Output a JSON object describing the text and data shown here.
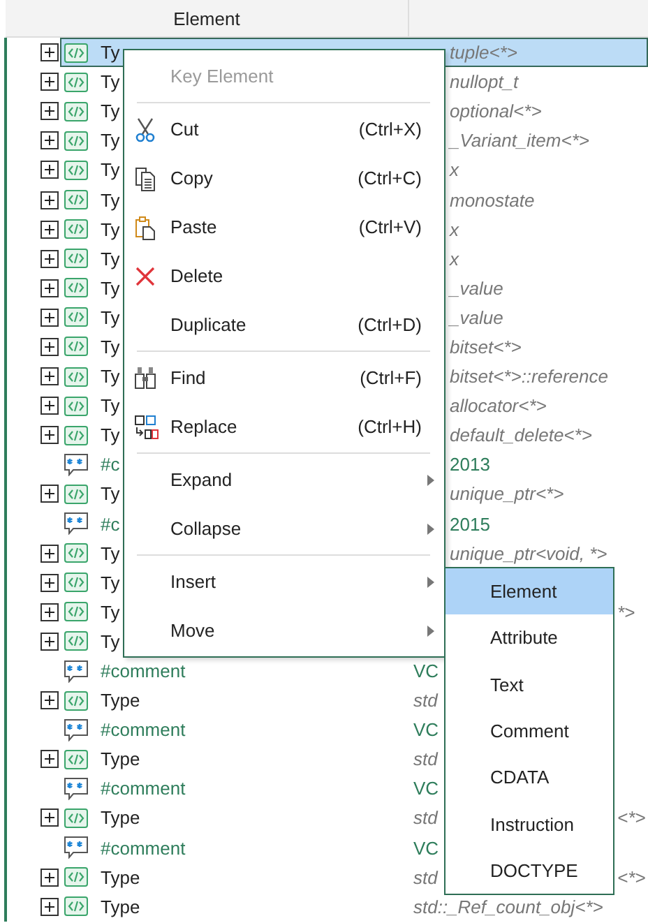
{
  "columns": [
    {
      "label": "Element"
    }
  ],
  "rows": [
    {
      "kind": "element",
      "name": "Ty",
      "value": "tuple<*>",
      "selected": true,
      "expanded": false
    },
    {
      "kind": "element",
      "name": "Ty",
      "value": "nullopt_t",
      "selected": false,
      "expanded": false
    },
    {
      "kind": "element",
      "name": "Ty",
      "value": "optional<*>",
      "selected": false,
      "expanded": false
    },
    {
      "kind": "element",
      "name": "Ty",
      "value": "_Variant_item<*>",
      "selected": false,
      "expanded": false
    },
    {
      "kind": "element",
      "name": "Ty",
      "value": "x",
      "selected": false,
      "expanded": false
    },
    {
      "kind": "element",
      "name": "Ty",
      "value": "monostate",
      "selected": false,
      "expanded": false
    },
    {
      "kind": "element",
      "name": "Ty",
      "value": "x",
      "selected": false,
      "expanded": false
    },
    {
      "kind": "element",
      "name": "Ty",
      "value": "x",
      "selected": false,
      "expanded": false
    },
    {
      "kind": "element",
      "name": "Ty",
      "value": "_value",
      "selected": false,
      "expanded": false
    },
    {
      "kind": "element",
      "name": "Ty",
      "value": "_value",
      "selected": false,
      "expanded": false
    },
    {
      "kind": "element",
      "name": "Ty",
      "value": "bitset<*>",
      "selected": false,
      "expanded": false
    },
    {
      "kind": "element",
      "name": "Ty",
      "value": "bitset<*>::reference",
      "selected": false,
      "expanded": false
    },
    {
      "kind": "element",
      "name": "Ty",
      "value": "allocator<*>",
      "selected": false,
      "expanded": false
    },
    {
      "kind": "element",
      "name": "Ty",
      "value": "default_delete<*>",
      "selected": false,
      "expanded": false
    },
    {
      "kind": "comment",
      "name": "#c",
      "value": "2013",
      "selected": false
    },
    {
      "kind": "element",
      "name": "Ty",
      "value": "unique_ptr<*>",
      "selected": false,
      "expanded": false
    },
    {
      "kind": "comment",
      "name": "#c",
      "value": "2015",
      "selected": false
    },
    {
      "kind": "element",
      "name": "Ty",
      "value": "unique_ptr<void, *>",
      "selected": false,
      "expanded": false
    },
    {
      "kind": "element",
      "name": "Ty",
      "selected": false,
      "expanded": false
    },
    {
      "kind": "element",
      "name": "Ty",
      "value_end": "*>",
      "selected": false,
      "expanded": false
    },
    {
      "kind": "element",
      "name": "Ty",
      "selected": false,
      "expanded": false
    },
    {
      "kind": "comment",
      "name": "#comment",
      "value": "VC",
      "selected": false
    },
    {
      "kind": "element",
      "name": "Type",
      "value": "std",
      "selected": false,
      "expanded": false
    },
    {
      "kind": "comment",
      "name": "#comment",
      "value": "VC",
      "selected": false
    },
    {
      "kind": "element",
      "name": "Type",
      "value": "std",
      "selected": false,
      "expanded": false
    },
    {
      "kind": "comment",
      "name": "#comment",
      "value": "VC",
      "selected": false
    },
    {
      "kind": "element",
      "name": "Type",
      "value": "std",
      "value_end": "<*>",
      "selected": false,
      "expanded": false
    },
    {
      "kind": "comment",
      "name": "#comment",
      "value": "VC",
      "selected": false
    },
    {
      "kind": "element",
      "name": "Type",
      "value": "std",
      "value_end": "<*>",
      "selected": false,
      "expanded": false
    },
    {
      "kind": "element",
      "name": "Type",
      "value": "std::_Ref_count_obj<*>",
      "selected": false,
      "expanded": false
    }
  ],
  "context_menu": {
    "items": [
      {
        "kind": "label",
        "label": "Key Element"
      },
      {
        "kind": "separator"
      },
      {
        "kind": "command",
        "label": "Cut",
        "shortcut": "(Ctrl+X)"
      },
      {
        "kind": "command",
        "label": "Copy",
        "shortcut": "(Ctrl+C)"
      },
      {
        "kind": "command",
        "label": "Paste",
        "shortcut": "(Ctrl+V)"
      },
      {
        "kind": "command",
        "label": "Delete"
      },
      {
        "kind": "command",
        "label": "Duplicate",
        "shortcut": "(Ctrl+D)"
      },
      {
        "kind": "separator"
      },
      {
        "kind": "command",
        "label": "Find",
        "shortcut": "(Ctrl+F)"
      },
      {
        "kind": "command",
        "label": "Replace",
        "shortcut": "(Ctrl+H)"
      },
      {
        "kind": "separator"
      },
      {
        "kind": "submenu",
        "label": "Expand"
      },
      {
        "kind": "submenu",
        "label": "Collapse"
      },
      {
        "kind": "separator"
      },
      {
        "kind": "submenu",
        "label": "Insert"
      },
      {
        "kind": "submenu",
        "label": "Move"
      }
    ]
  },
  "submenu": {
    "items": [
      {
        "label": "Element",
        "selected": true
      },
      {
        "label": "Attribute",
        "selected": false
      },
      {
        "label": "Text",
        "selected": false
      },
      {
        "label": "Comment",
        "selected": false
      },
      {
        "label": "CDATA",
        "selected": false
      },
      {
        "label": "Instruction",
        "selected": false
      },
      {
        "label": "DOCTYPE",
        "selected": false
      }
    ]
  }
}
